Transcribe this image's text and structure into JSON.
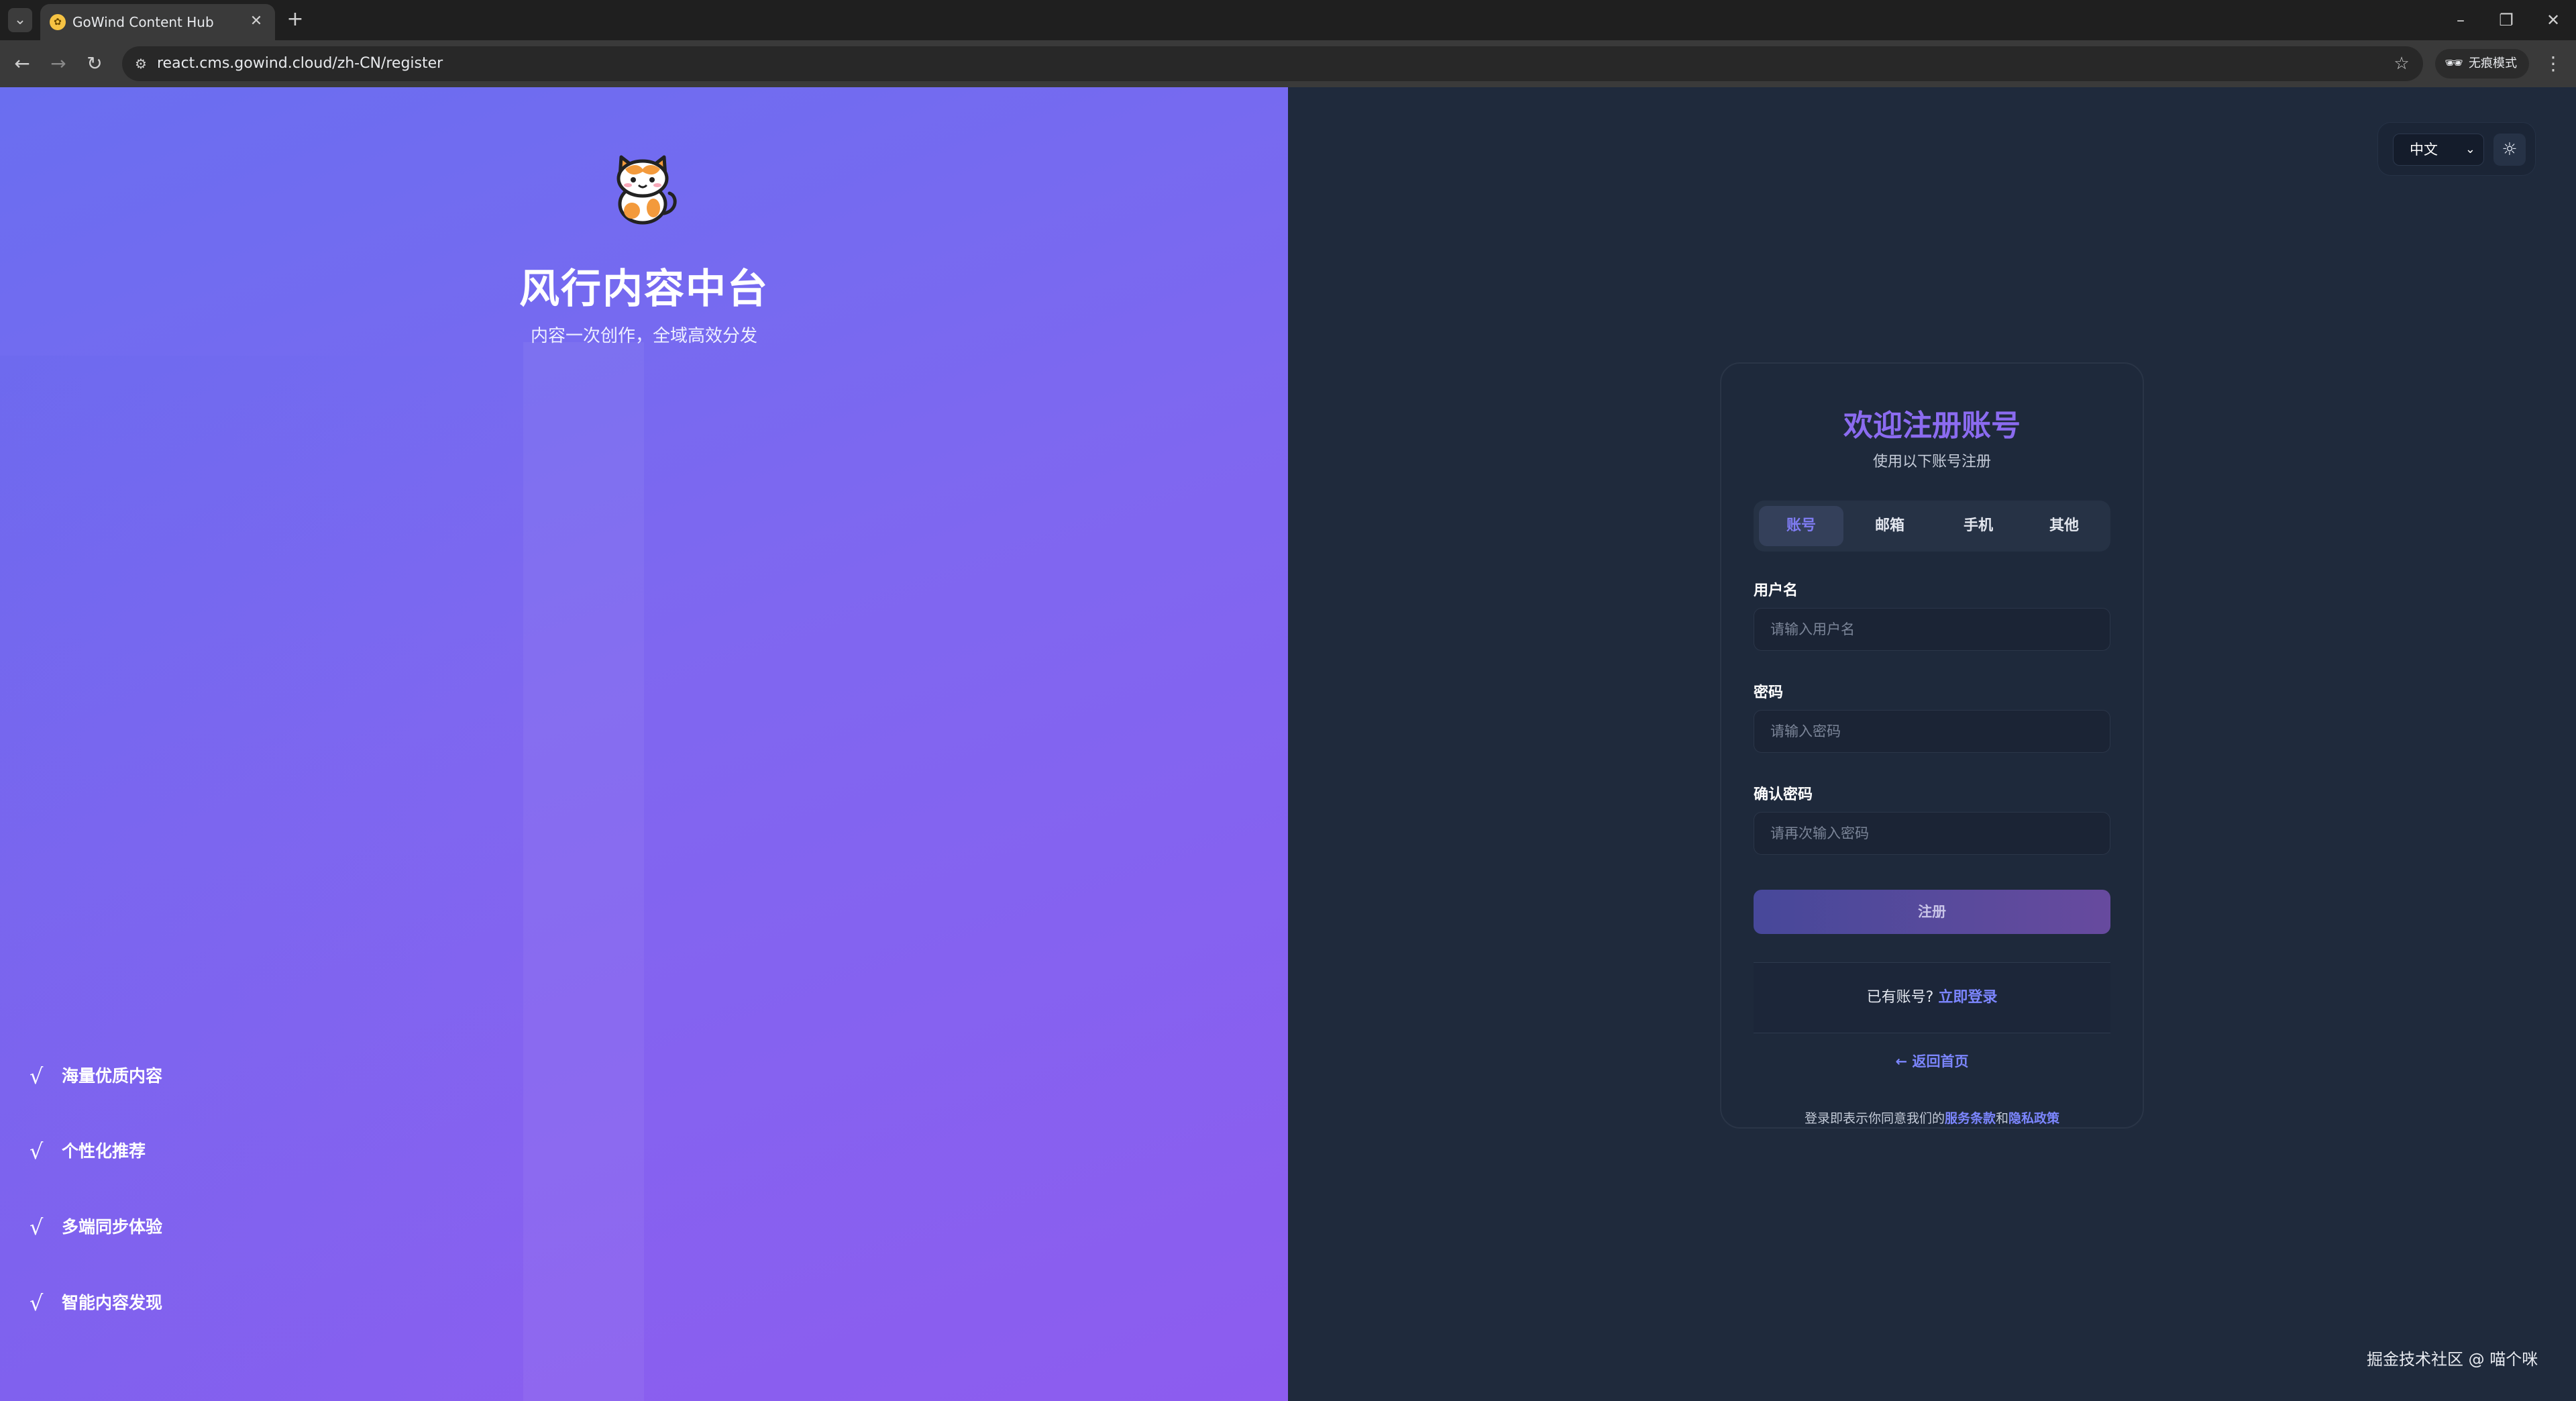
{
  "browser": {
    "tab_title": "GoWind Content Hub",
    "url": "react.cms.gowind.cloud/zh-CN/register",
    "incognito_label": "无痕模式",
    "icons": {
      "tab_list": "chevron-down-icon",
      "close": "close-icon",
      "new_tab": "plus-icon",
      "back": "arrow-left-icon",
      "forward": "arrow-right-icon",
      "reload": "reload-icon",
      "site_info": "site-info-icon",
      "bookmark": "star-icon",
      "incognito": "incognito-icon",
      "menu": "more-vert-icon"
    },
    "glyphs": {
      "tab_list": "⌄",
      "close": "✕",
      "new_tab": "+",
      "minimize": "–",
      "restore": "❐",
      "window_close": "✕",
      "back": "←",
      "forward": "→",
      "reload": "↻",
      "site_info": "⚙",
      "bookmark": "☆",
      "incognito": "🕶",
      "menu": "⋮"
    }
  },
  "hero": {
    "brand_title": "风行内容中台",
    "brand_subtitle": "内容一次创作，全域高效分发",
    "check_glyph": "√",
    "features": [
      "海量优质内容",
      "个性化推荐",
      "多端同步体验",
      "智能内容发现"
    ],
    "colors": {
      "gradient_start": "#6a6ef0",
      "gradient_end": "#8d5cef"
    }
  },
  "controls": {
    "language_selected": "中文",
    "select_chevron": "⌄",
    "theme_glyph": "☼"
  },
  "register": {
    "title": "欢迎注册账号",
    "subtitle": "使用以下账号注册",
    "tabs": [
      "账号",
      "邮箱",
      "手机",
      "其他"
    ],
    "active_tab": "账号",
    "fields": {
      "username": {
        "label": "用户名",
        "placeholder": "请输入用户名"
      },
      "password": {
        "label": "密码",
        "placeholder": "请输入密码"
      },
      "confirm": {
        "label": "确认密码",
        "placeholder": "请再次输入密码"
      }
    },
    "submit_label": "注册",
    "have_account_text": "已有账号?",
    "login_link": "立即登录",
    "back_home": "← 返回首页",
    "agree_prefix": "登录即表示你同意我们的",
    "terms_link": "服务条款",
    "agree_and": "和",
    "privacy_link": "隐私政策",
    "colors": {
      "accent": "#7c86ff",
      "title": "#8b6bf0",
      "card_bg": "#1e293b",
      "page_bg": "#1f2a3c"
    }
  },
  "watermark": "掘金技术社区 @ 喵个咪"
}
